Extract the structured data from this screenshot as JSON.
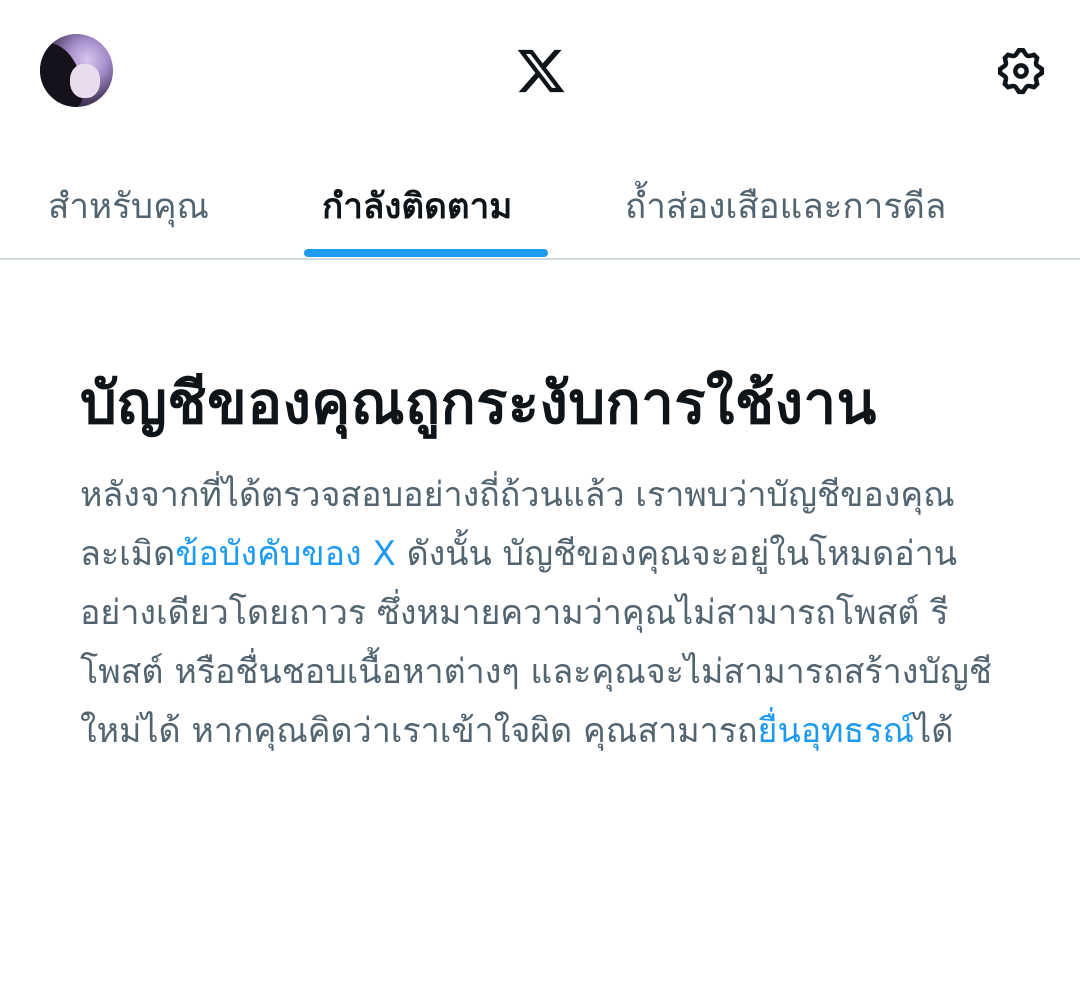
{
  "header": {
    "avatar_icon": "user-avatar",
    "logo_icon": "x-logo-icon",
    "settings_icon": "gear-icon"
  },
  "tabs": [
    {
      "label": "สำหรับคุณ",
      "active": false
    },
    {
      "label": "กำลังติดตาม",
      "active": true
    },
    {
      "label": "ถ้ำส่องเสือและการดีล",
      "active": false
    }
  ],
  "notice": {
    "title": "บัญชีของคุณถูกระงับการใช้งาน",
    "body_part1": "หลังจากที่ได้ตรวจสอบอย่างถี่ถ้วนแล้ว เราพบว่าบัญชีของคุณละเมิด",
    "rules_link": "ข้อบังคับของ X",
    "body_part2": " ดังนั้น บัญชีของคุณจะอยู่ในโหมดอ่านอย่างเดียวโดยถาวร ซึ่งหมายความว่าคุณไม่สามารถโพสต์ รีโพสต์ หรือชื่นชอบเนื้อหาต่างๆ และคุณจะไม่สามารถสร้างบัญชีใหม่ได้ หากคุณคิดว่าเราเข้าใจผิด คุณสามารถ",
    "appeal_link": "ยื่นอุทธรณ์",
    "body_part3": "ได้"
  },
  "colors": {
    "accent": "#1d9bf0",
    "text_primary": "#0f1419",
    "text_secondary": "#536471",
    "divider": "#cfd9de"
  }
}
